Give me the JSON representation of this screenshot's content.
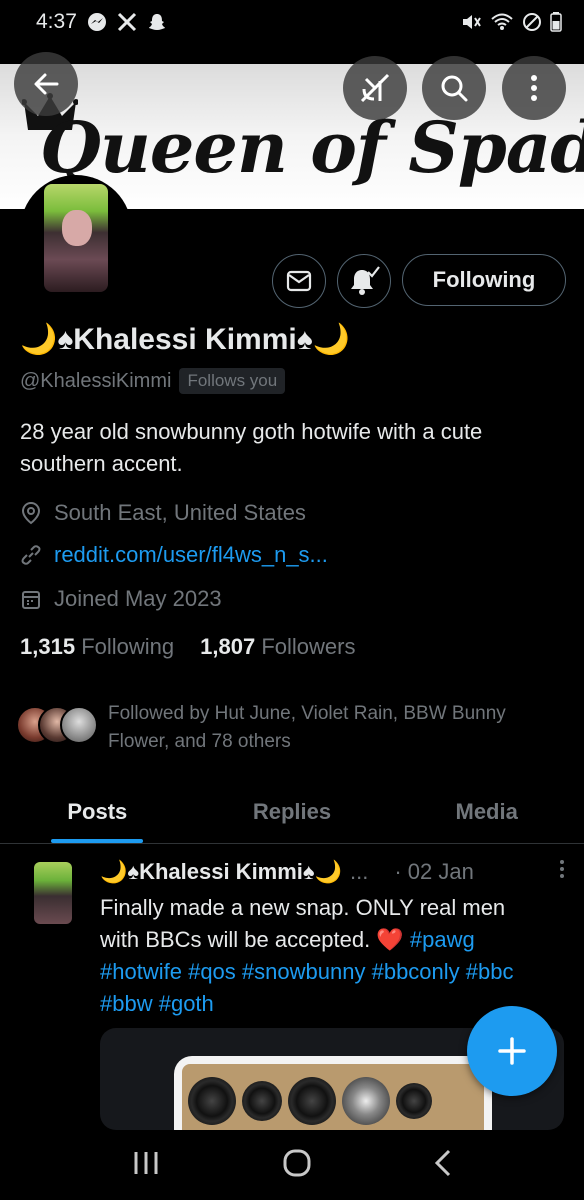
{
  "status_bar": {
    "time": "4:37",
    "left_icons": [
      "messenger-icon",
      "x-icon",
      "snapchat-icon"
    ],
    "right_icons": [
      "mute-icon",
      "wifi-icon",
      "dnd-icon",
      "battery-icon"
    ]
  },
  "banner": {
    "title": "Queen of Spades"
  },
  "header_buttons": [
    "back-arrow-icon",
    "grok-icon",
    "search-icon",
    "more-vertical-icon"
  ],
  "profile": {
    "display_name": "🌙♠Khalessi Kimmi♠🌙",
    "handle": "@KhalessiKimmi",
    "follows_you": "Follows you",
    "bio": "28 year old snowbunny goth hotwife with a cute southern accent.",
    "location": "South East, United States",
    "link": "reddit.com/user/fl4ws_n_s...",
    "joined": "Joined May 2023",
    "following_count": "1,315",
    "following_label": "Following",
    "followers_count": "1,807",
    "followers_label": "Followers",
    "followed_by": "Followed by Hut June, Violet Rain, BBW Bunny Flower, and 78 others"
  },
  "actions": {
    "message_icon": "envelope-icon",
    "notify_icon": "bell-check-icon",
    "following_button": "Following"
  },
  "tabs": [
    {
      "label": "Posts",
      "active": true
    },
    {
      "label": "Replies",
      "active": false
    },
    {
      "label": "Media",
      "active": false
    }
  ],
  "post": {
    "author": "🌙♠Khalessi Kimmi♠🌙",
    "ellipsis": "...",
    "date": "· 02 Jan",
    "text": "Finally made a new snap. ONLY real men with BBCs will be accepted. ❤️ ",
    "hashtags": [
      "#pawg",
      "#hotwife",
      "#qos",
      "#snowbunny",
      "#bbconly",
      "#bbc",
      "#bbw",
      "#goth"
    ]
  },
  "fab_icon": "plus-icon",
  "nav_bar": [
    "recents-icon",
    "home-icon",
    "back-icon"
  ],
  "colors": {
    "accent": "#1d9bf0",
    "background": "#000000",
    "secondary_text": "#71767b"
  }
}
